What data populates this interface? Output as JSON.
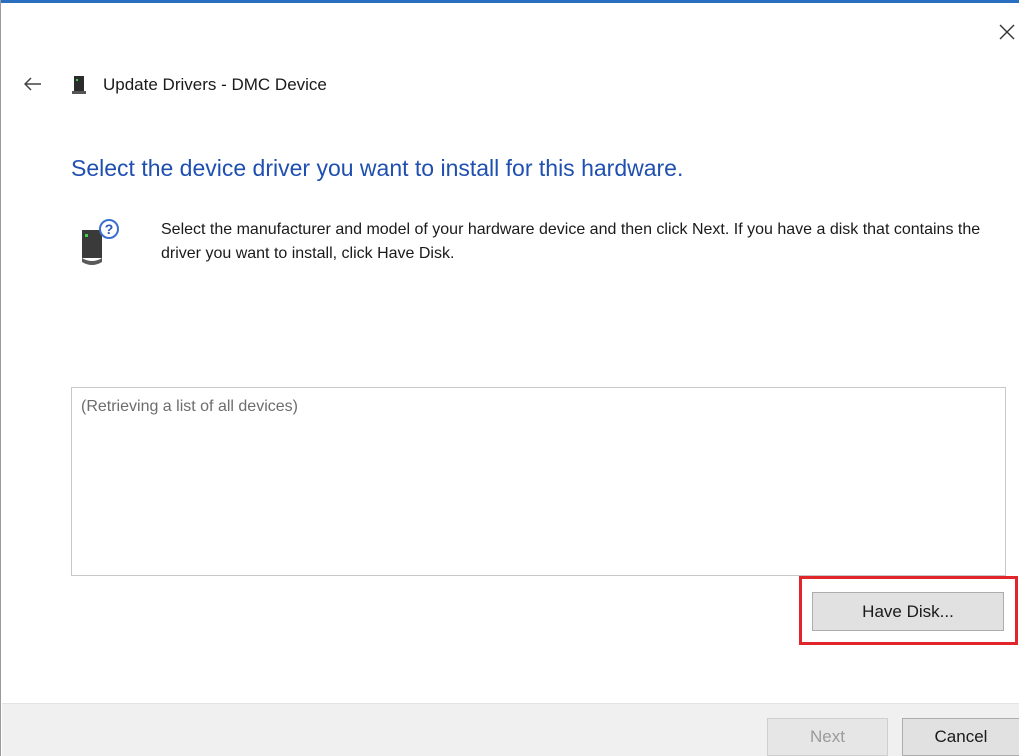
{
  "window": {
    "title": "Update Drivers - DMC Device",
    "close_glyph": "×",
    "back_glyph": "←"
  },
  "content": {
    "heading": "Select the device driver you want to install for this hardware.",
    "instruction": "Select the manufacturer and model of your hardware device and then click Next. If you have a disk that contains the driver you want to install, click Have Disk.",
    "device_list_status": "(Retrieving a list of all devices)",
    "have_disk_label": "Have Disk..."
  },
  "footer": {
    "next_label": "Next",
    "cancel_label": "Cancel"
  },
  "icons": {
    "back": "back-arrow-icon",
    "close": "close-icon",
    "title": "device-icon",
    "info": "hardware-question-icon"
  },
  "colors": {
    "heading": "#1f4fb0",
    "highlight": "#e0252b",
    "accent_top": "#2b6fc1"
  }
}
